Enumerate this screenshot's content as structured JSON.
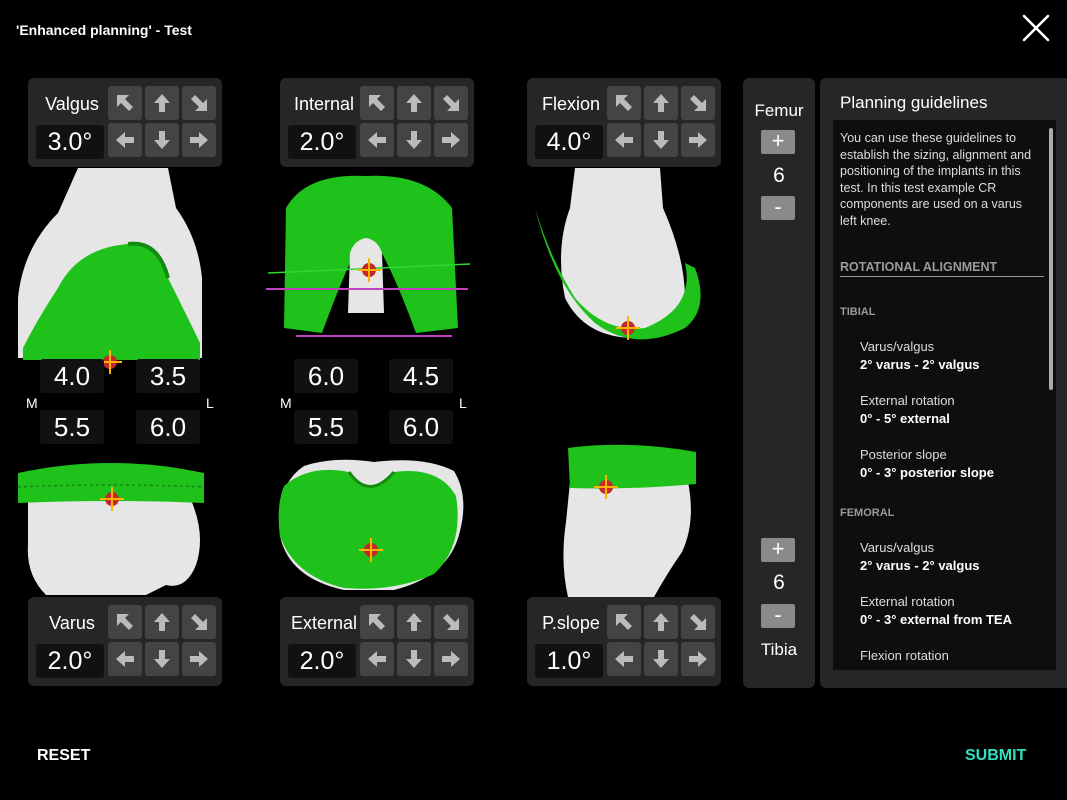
{
  "title": "'Enhanced planning' - Test",
  "colors": {
    "implant": "#1fc21a",
    "bone": "#e8e8e8",
    "accent": "#2fe0c0",
    "panel": "#262626"
  },
  "top_controls": [
    {
      "label": "Valgus",
      "value": "3.0°"
    },
    {
      "label": "Internal",
      "value": "2.0°"
    },
    {
      "label": "Flexion",
      "value": "4.0°"
    }
  ],
  "bottom_controls": [
    {
      "label": "Varus",
      "value": "2.0°"
    },
    {
      "label": "External",
      "value": "2.0°"
    },
    {
      "label": "P.slope",
      "value": "1.0°"
    }
  ],
  "measurements": {
    "left": {
      "top": [
        "4.0",
        "3.5"
      ],
      "bottom": [
        "5.5",
        "6.0"
      ]
    },
    "middle": {
      "top": [
        "6.0",
        "4.5"
      ],
      "bottom": [
        "5.5",
        "6.0"
      ]
    },
    "medial_label": "M",
    "lateral_label": "L"
  },
  "sizes": {
    "femur_label": "Femur",
    "femur_value": "6",
    "tibia_label": "Tibia",
    "tibia_value": "6",
    "plus": "+",
    "minus": "-"
  },
  "guidelines": {
    "heading": "Planning guidelines",
    "intro": "You can use these guidelines to establish the sizing, alignment and positioning of the implants in this test. In this test example CR components are used on a varus left knee.",
    "section": "ROTATIONAL ALIGNMENT",
    "tibial_header": "TIBIAL",
    "tibial": [
      {
        "name": "Varus/valgus",
        "value": "2° varus - 2° valgus"
      },
      {
        "name": "External rotation",
        "value": "0° - 5° external"
      },
      {
        "name": "Posterior slope",
        "value": "0° - 3° posterior slope"
      }
    ],
    "femoral_header": "FEMORAL",
    "femoral": [
      {
        "name": "Varus/valgus",
        "value": "2° varus - 2° valgus"
      },
      {
        "name": "External rotation",
        "value": "0° - 3° external from TEA"
      },
      {
        "name": "Flexion rotation",
        "value": ""
      }
    ]
  },
  "reset_label": "RESET",
  "submit_label": "SUBMIT"
}
